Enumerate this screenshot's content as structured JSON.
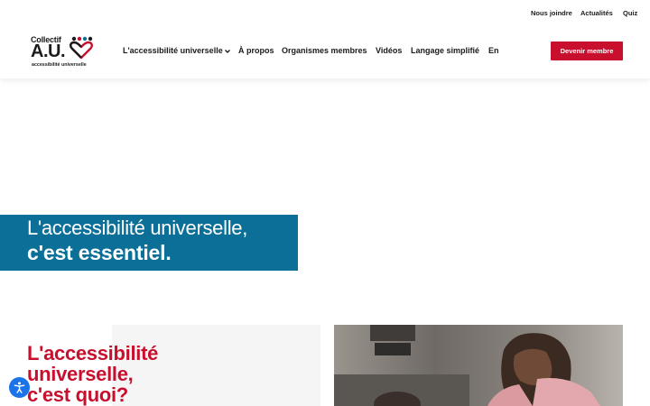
{
  "topbar": {
    "links": [
      "Nous joindre",
      "Actualités",
      "Quiz"
    ]
  },
  "logo": {
    "top": "Collectif",
    "mark": "A.U.",
    "sub": "accessibilité universelle"
  },
  "nav": {
    "items": [
      "L'accessibilité universelle",
      "À propos",
      "Organismes membres",
      "Vidéos",
      "Langage simplifié",
      "En"
    ],
    "cta": "Devenir membre"
  },
  "hero": {
    "line1": "L'accessibilité universelle,",
    "line2": "c'est essentiel."
  },
  "section": {
    "title_lines": [
      "L'accessibilité",
      "universelle,",
      "c'est quoi?"
    ]
  },
  "icons": {
    "dropdown": "chevron-down-icon",
    "accessibility": "accessibility-icon",
    "logo_mark": "heart-people-icon"
  },
  "colors": {
    "brand_red": "#c8102e",
    "brand_blue": "#0b6f98",
    "text": "#1b1b1b"
  }
}
